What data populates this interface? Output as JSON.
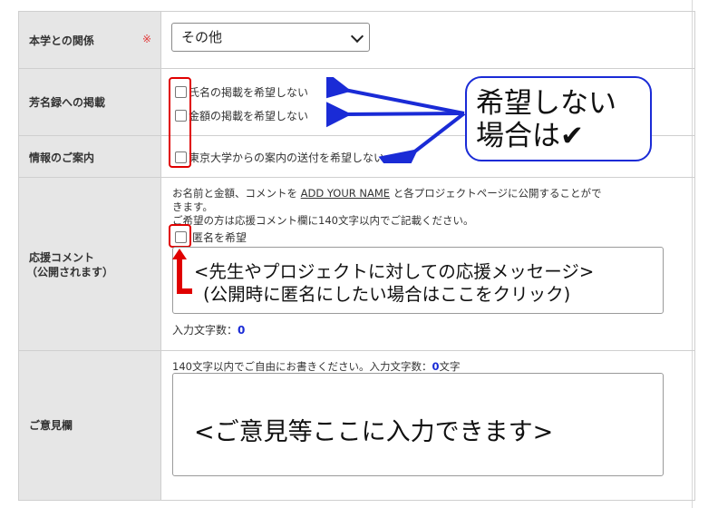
{
  "rows": {
    "relation": {
      "label": "本学との関係",
      "required_mark": "※",
      "select_value": "その他"
    },
    "donor_list": {
      "label": "芳名録への掲載",
      "option1": "氏名の掲載を希望しない",
      "option2": "金額の掲載を希望しない"
    },
    "info": {
      "label": "情報のご案内",
      "option": "東京大学からの案内の送付を希望しない"
    },
    "comment": {
      "label_line1": "応援コメント",
      "label_line2": "（公開されます）",
      "desc_part1": "お名前と金額、コメントを",
      "desc_link": "ADD YOUR NAME",
      "desc_part2": "と各プロジェクトページに公開することがで",
      "desc_line2": "きます。",
      "desc_line3": "ご希望の方は応援コメント欄に140文字以内でご記載ください。",
      "anon_label": "匿名を希望",
      "textarea_line1": "<先生やプロジェクトに対しての応援メッセージ>",
      "textarea_line2": "(公開時に匿名にしたい場合はここをクリック)",
      "count_label": "入力文字数：",
      "count_value": "0"
    },
    "opinion": {
      "label": "ご意見欄",
      "hint_prefix": "140文字以内でご自由にお書きください。入力文字数：",
      "hint_count": "0",
      "hint_suffix": "文字",
      "textarea_text": "<ご意見等ここに入力できます>"
    }
  },
  "callout": {
    "line1": "希望しない",
    "line2": "場合は",
    "check_symbol": "✔"
  },
  "colors": {
    "annotation_red": "#e00000",
    "annotation_blue": "#1a2bd6",
    "count_blue": "#1a2bd6"
  }
}
